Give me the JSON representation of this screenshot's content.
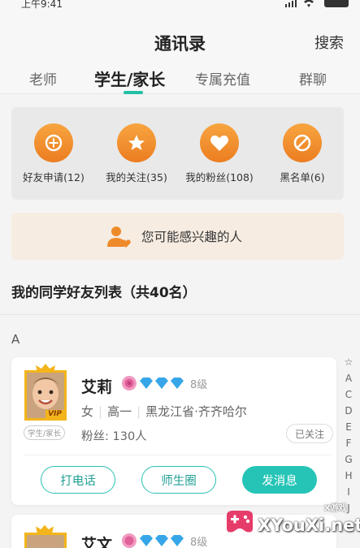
{
  "status": {
    "time": "上午9:41"
  },
  "header": {
    "title": "通讯录",
    "search": "搜索"
  },
  "tabs": [
    "老师",
    "学生/家长",
    "专属充值",
    "群聊"
  ],
  "quick": [
    {
      "label": "好友申请(12)",
      "icon": "plus-icon"
    },
    {
      "label": "我的关注(35)",
      "icon": "star-icon"
    },
    {
      "label": "我的粉丝(108)",
      "icon": "heart-icon"
    },
    {
      "label": "黑名单(6)",
      "icon": "block-icon"
    }
  ],
  "interest": {
    "text": "您可能感兴趣的人"
  },
  "list_title": "我的同学好友列表（共40名）",
  "section_letter": "A",
  "friends": [
    {
      "name": "艾莉",
      "vip": "VIP",
      "role": "学生/家长",
      "level": "8级",
      "gender": "女",
      "grade": "高一",
      "location": "黑龙江省·齐齐哈尔",
      "fans": "粉丝: 130人",
      "follow_status": "已关注",
      "actions": [
        "打电话",
        "师生圈",
        "发消息"
      ]
    },
    {
      "name": "艾文",
      "level": "8级"
    }
  ],
  "index": [
    "☆",
    "A",
    "C",
    "D",
    "E",
    "F",
    "G",
    "H",
    "I",
    "J"
  ],
  "watermark": {
    "brand": "XYouXi.net",
    "small": "X游戏"
  },
  "colors": {
    "accent": "#22c1a6",
    "orange": "#ef8a2a",
    "interest_bg": "#f6ece1"
  }
}
